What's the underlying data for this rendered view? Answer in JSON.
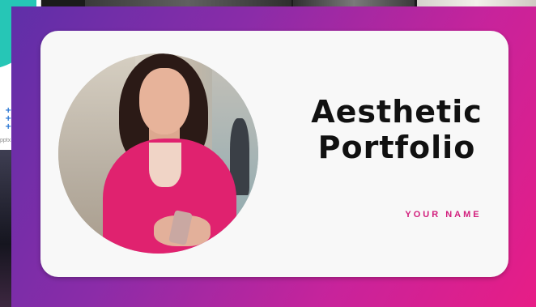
{
  "background": {
    "left_thumbnail_caption": "pptx.com",
    "gradient_colors": [
      "#5f2fa8",
      "#8a2ca8",
      "#c8239b",
      "#e71d86"
    ]
  },
  "slide": {
    "title_line1": "Aesthetic",
    "title_line2": "Portfolio",
    "subtitle": "YOUR NAME",
    "accent_color": "#d21f7d",
    "photo": "woman-in-pink-blazer-using-phone"
  }
}
